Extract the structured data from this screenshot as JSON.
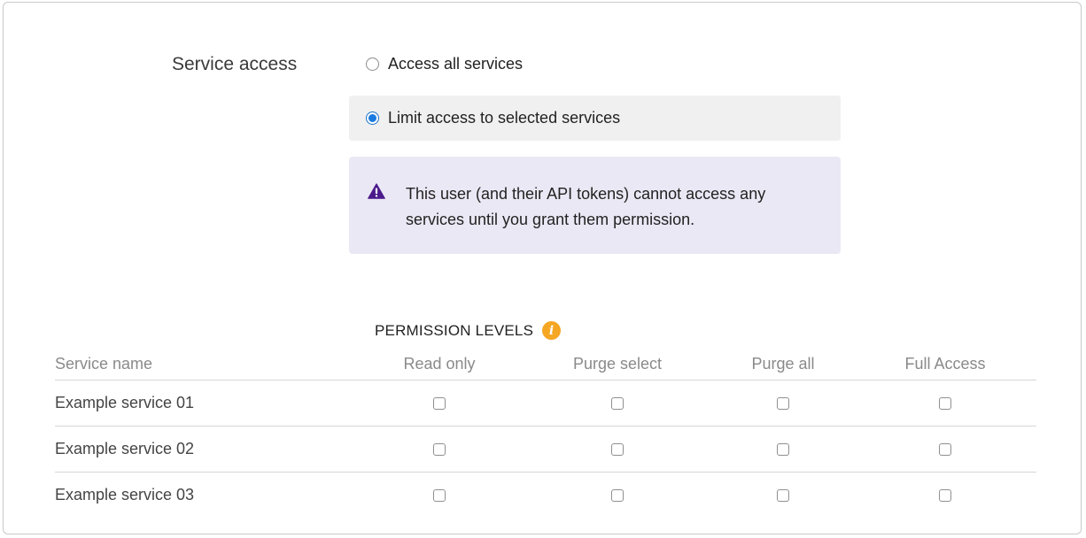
{
  "section_label": "Service access",
  "options": {
    "all": {
      "label": "Access all services",
      "checked": false
    },
    "limit": {
      "label": "Limit access to selected services",
      "checked": true
    }
  },
  "warning": {
    "icon": "warning-triangle-icon",
    "text": "This user (and their API tokens) cannot access any services until you grant them permission."
  },
  "permission_levels": {
    "title": "PERMISSION LEVELS",
    "info_icon": "info-icon",
    "info_glyph": "i"
  },
  "table": {
    "headers": [
      "Service name",
      "Read only",
      "Purge select",
      "Purge all",
      "Full Access"
    ],
    "rows": [
      {
        "name": "Example service 01",
        "read_only": false,
        "purge_select": false,
        "purge_all": false,
        "full_access": false
      },
      {
        "name": "Example service 02",
        "read_only": false,
        "purge_select": false,
        "purge_all": false,
        "full_access": false
      },
      {
        "name": "Example service 03",
        "read_only": false,
        "purge_select": false,
        "purge_all": false,
        "full_access": false
      }
    ]
  },
  "colors": {
    "warning_bg": "#ebe8f5",
    "warning_icon": "#4b1a8c",
    "radio_accent": "#1a7ae0",
    "info_icon": "#f5a623"
  }
}
